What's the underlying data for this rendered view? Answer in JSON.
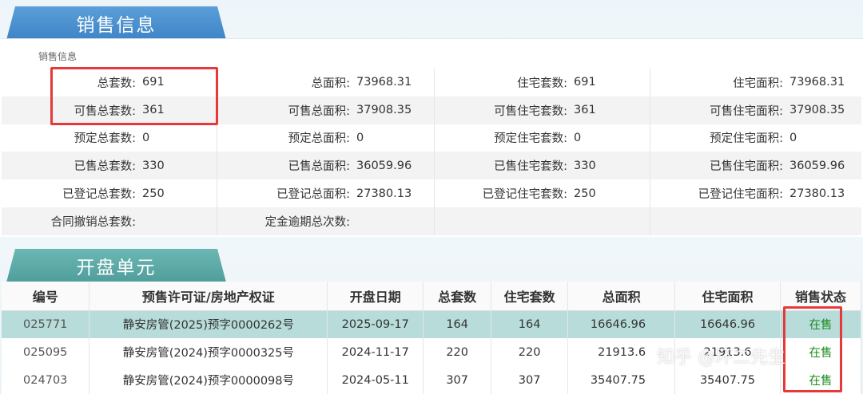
{
  "sales_tab": "销售信息",
  "sales_subtitle": "销售信息",
  "open_tab": "开盘单元",
  "info_rows": [
    [
      [
        "总套数:",
        "691"
      ],
      [
        "总面积:",
        "73968.31"
      ],
      [
        "住宅套数:",
        "691"
      ],
      [
        "住宅面积:",
        "73968.31"
      ]
    ],
    [
      [
        "可售总套数:",
        "361"
      ],
      [
        "可售总面积:",
        "37908.35"
      ],
      [
        "可售住宅套数:",
        "361"
      ],
      [
        "可售住宅面积:",
        "37908.35"
      ]
    ],
    [
      [
        "预定总套数:",
        "0"
      ],
      [
        "预定总面积:",
        "0"
      ],
      [
        "预定住宅套数:",
        "0"
      ],
      [
        "预定住宅面积:",
        "0"
      ]
    ],
    [
      [
        "已售总套数:",
        "330"
      ],
      [
        "已售总面积:",
        "36059.96"
      ],
      [
        "已售住宅套数:",
        "330"
      ],
      [
        "已售住宅面积:",
        "36059.96"
      ]
    ],
    [
      [
        "已登记总套数:",
        "250"
      ],
      [
        "已登记总面积:",
        "27380.13"
      ],
      [
        "已登记住宅套数:",
        "250"
      ],
      [
        "已登记住宅面积:",
        "27380.13"
      ]
    ],
    [
      [
        "合同撤销总套数:",
        ""
      ],
      [
        "定金逾期总次数:",
        ""
      ],
      [
        "",
        ""
      ],
      [
        "",
        ""
      ]
    ]
  ],
  "table": {
    "headers": [
      "编号",
      "预售许可证/房地产权证",
      "开盘日期",
      "总套数",
      "住宅套数",
      "总面积",
      "住宅面积",
      "销售状态"
    ],
    "rows": [
      [
        "025771",
        "静安房管(2025)预字0000262号",
        "2025-09-17",
        "164",
        "164",
        "16646.96",
        "16646.96",
        "在售"
      ],
      [
        "025095",
        "静安房管(2024)预字0000325号",
        "2024-11-17",
        "220",
        "220",
        "21913.6",
        "21913.6",
        "在售"
      ],
      [
        "024703",
        "静安房管(2024)预字0000098号",
        "2024-05-11",
        "307",
        "307",
        "35407.75",
        "35407.75",
        "在售"
      ]
    ]
  },
  "watermark": "知乎 @环二先生",
  "colors": {
    "highlight_box": "#e63a3a",
    "selected_row": "#b7dcd9",
    "status_green": "#1a8a1a"
  }
}
